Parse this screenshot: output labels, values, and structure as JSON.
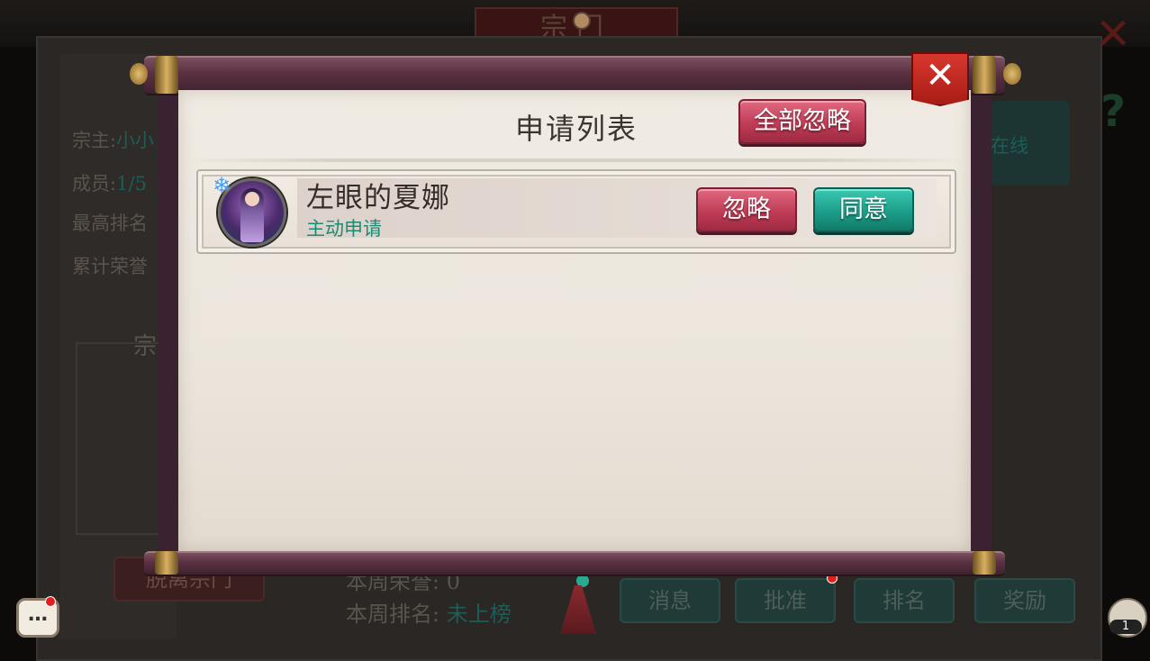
{
  "background": {
    "screen_title": "宗门",
    "left_info": [
      {
        "label": "宗主:",
        "value": "小小"
      },
      {
        "label": "成员:",
        "value": "1/5"
      },
      {
        "label": "最高排名",
        "value": ""
      },
      {
        "label": "累计荣誉",
        "value": ""
      }
    ],
    "section_label": "宗",
    "online_label": "在线",
    "leave_button": "脱离宗门",
    "weekly_honor": "本周荣誉: 0",
    "weekly_rank_label": "本周排名:",
    "weekly_rank_value": "未上榜",
    "bottom_tabs": [
      "消息",
      "批准",
      "排名",
      "奖励"
    ],
    "friends_count": "1"
  },
  "dialog": {
    "title": "申请列表",
    "ignore_all_label": "全部忽略",
    "close_label": "✕",
    "requests": [
      {
        "name": "左眼的夏娜",
        "status": "主动申请",
        "ignore_label": "忽略",
        "agree_label": "同意"
      }
    ]
  },
  "colors": {
    "accent_red": "#c03c56",
    "accent_teal": "#1c9e8a",
    "status_green": "#1f8a74",
    "paper": "#ebe5dc"
  }
}
